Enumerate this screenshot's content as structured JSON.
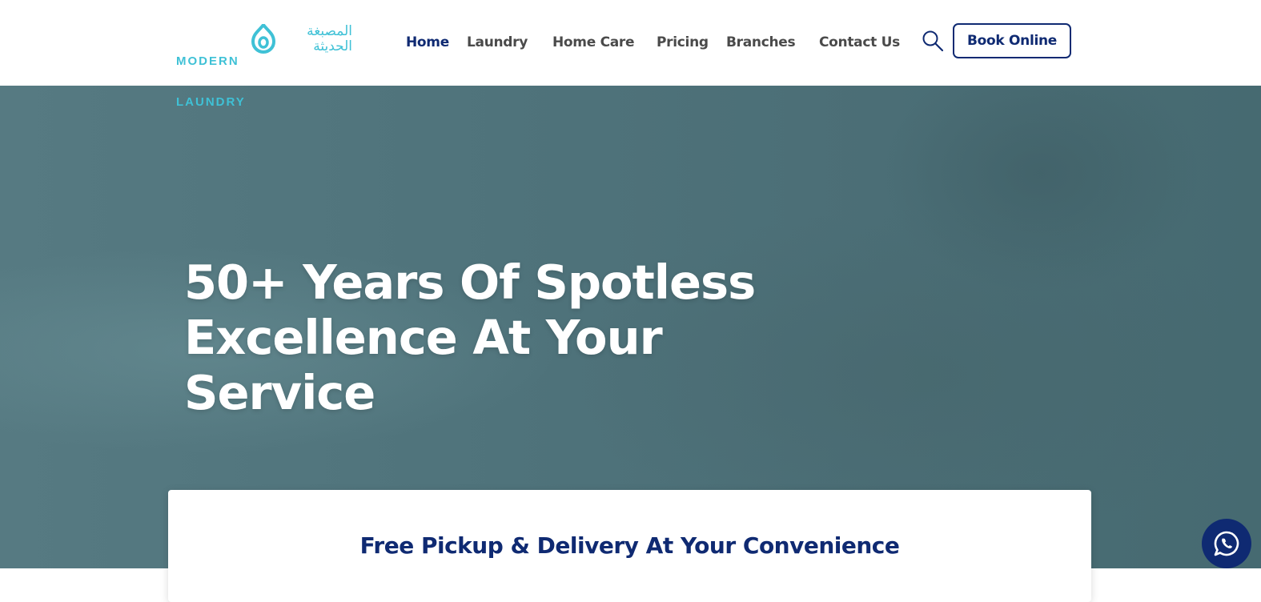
{
  "brand": {
    "name_en_line1": "MODERN",
    "name_en_line2": "LAUNDRY",
    "name_ar_line1": "المصبغة",
    "name_ar_line2": "الحديثة",
    "logo_icon": "drop-icon",
    "color": "#3fc1d6"
  },
  "nav": {
    "items": [
      {
        "label": "Home",
        "active": true
      },
      {
        "label": "Laundry"
      },
      {
        "label": "Home Care"
      },
      {
        "label": "Pricing"
      },
      {
        "label": "Branches"
      },
      {
        "label": "Contact Us"
      }
    ],
    "search_icon": "search-icon",
    "book_label": "Book Online"
  },
  "hero": {
    "title": "50+ Years Of Spotless Excellence At Your Service"
  },
  "card": {
    "title": "Free Pickup & Delivery At Your Convenience"
  },
  "floating": {
    "whatsapp_icon": "whatsapp-icon"
  },
  "colors": {
    "primary": "#0f2a72",
    "accent": "#3fc1d6",
    "nav_text": "#4a4a4a",
    "hero_bg": "#567a82"
  }
}
